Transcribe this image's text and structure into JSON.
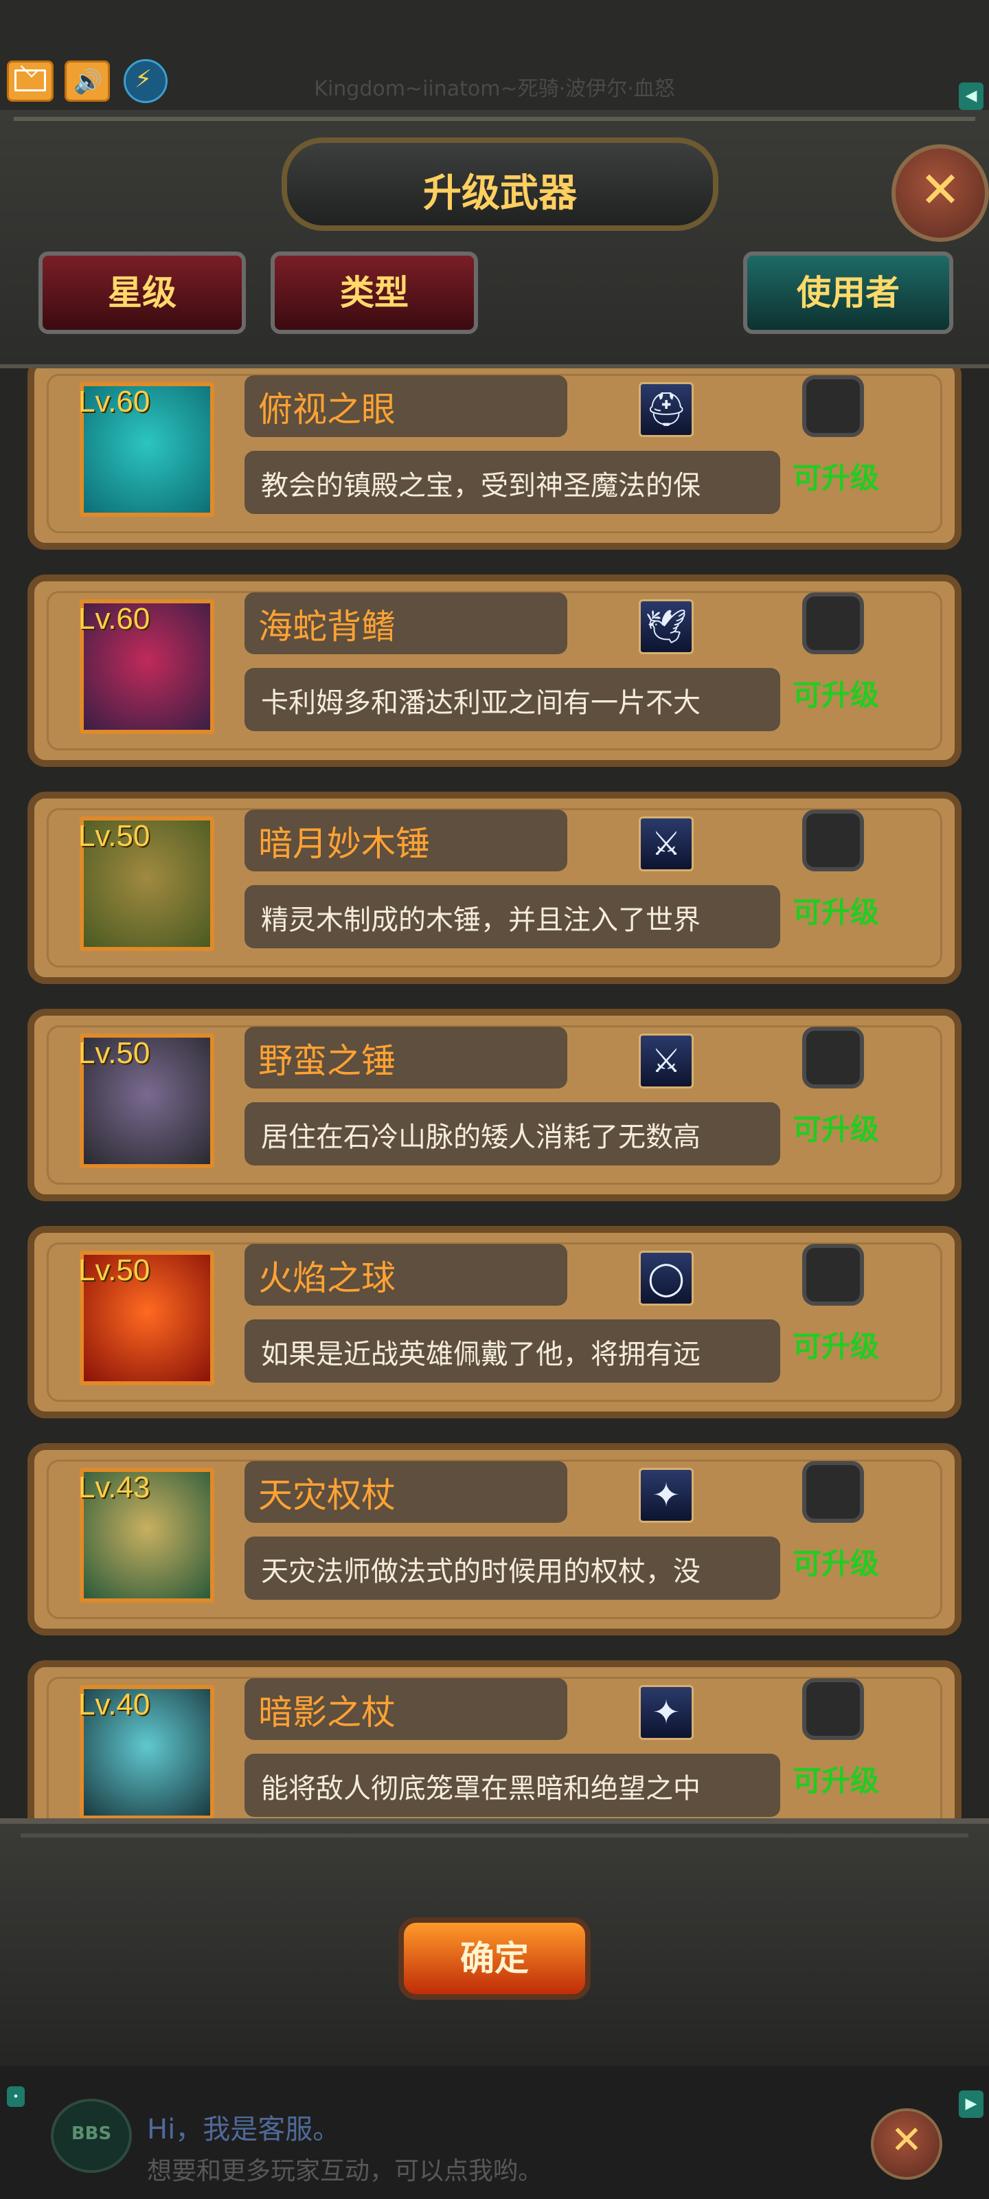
{
  "top": {
    "title": "Kingdom~iinatom~死骑·波伊尔·血怒",
    "icons": [
      "mail-icon",
      "sound-icon",
      "energy-icon"
    ],
    "arrow": "◀"
  },
  "header": {
    "title": "升级武器",
    "close_glyph": "✕",
    "tabs": [
      {
        "label": "星级"
      },
      {
        "label": "类型"
      },
      {
        "label": "使用者"
      }
    ]
  },
  "weapons": [
    {
      "level": "Lv.60",
      "name": "俯视之眼",
      "desc": "教会的镇殿之宝，受到神圣魔法的保",
      "status": "可升级",
      "type_icon": "helmet-icon",
      "colors": [
        "#0d6e75",
        "#2cc5c0"
      ]
    },
    {
      "level": "Lv.60",
      "name": "海蛇背鳍",
      "desc": "卡利姆多和潘达利亚之间有一片不大",
      "status": "可升级",
      "type_icon": "wing-icon",
      "colors": [
        "#3a1f45",
        "#c02a5a"
      ]
    },
    {
      "level": "Lv.50",
      "name": "暗月妙木锤",
      "desc": "精灵木制成的木锤，并且注入了世界",
      "status": "可升级",
      "type_icon": "sword-icon",
      "colors": [
        "#4a5a22",
        "#a08a40"
      ]
    },
    {
      "level": "Lv.50",
      "name": "野蛮之锤",
      "desc": "居住在石冷山脉的矮人消耗了无数高",
      "status": "可升级",
      "type_icon": "sword-icon",
      "colors": [
        "#2a2a30",
        "#7a6a90"
      ]
    },
    {
      "level": "Lv.50",
      "name": "火焰之球",
      "desc": "如果是近战英雄佩戴了他，将拥有远",
      "status": "可升级",
      "type_icon": "ring-icon",
      "colors": [
        "#8a1208",
        "#ff6a20"
      ]
    },
    {
      "level": "Lv.43",
      "name": "天灾权杖",
      "desc": "天灾法师做法式的时候用的权杖，没",
      "status": "可升级",
      "type_icon": "staff-icon",
      "colors": [
        "#2a5a3a",
        "#c8b060"
      ]
    },
    {
      "level": "Lv.40",
      "name": "暗影之杖",
      "desc": "能将敌人彻底笼罩在黑暗和绝望之中",
      "status": "可升级",
      "type_icon": "staff-icon",
      "colors": [
        "#1a3a40",
        "#60c8d0"
      ]
    }
  ],
  "footer": {
    "confirm": "确定"
  },
  "bbs": {
    "logo": "BBS",
    "hi": "Hi，我是客服。",
    "sub": "想要和更多玩家互动，可以点我哟。",
    "close_glyph": "✕",
    "arrow": "▶"
  }
}
